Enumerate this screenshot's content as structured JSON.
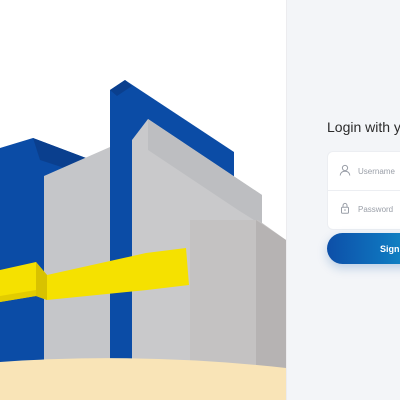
{
  "login": {
    "title": "Login with y",
    "username_placeholder": "Username",
    "password_placeholder": "Password",
    "signin_label": "Sign"
  },
  "icons": {
    "username": "user-icon",
    "password": "lock-icon"
  },
  "colors": {
    "brand_blue": "#0a4aa6",
    "brand_yellow": "#f5e100",
    "building_grey": "#c8c8c8",
    "ground_sand": "#f9e4b7",
    "panel_background": "#f3f5f8"
  }
}
